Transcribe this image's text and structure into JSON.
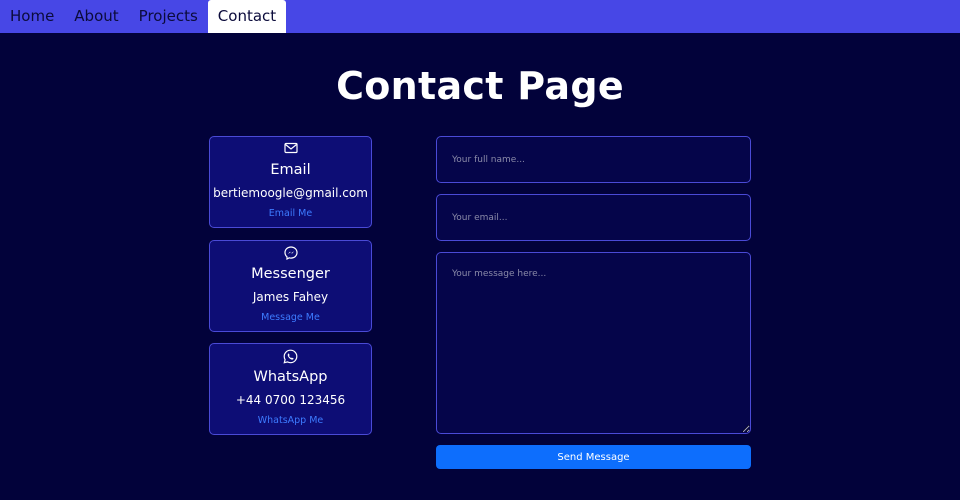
{
  "nav": {
    "items": [
      {
        "label": "Home"
      },
      {
        "label": "About"
      },
      {
        "label": "Projects"
      },
      {
        "label": "Contact"
      }
    ],
    "active": "Contact"
  },
  "page": {
    "title": "Contact Page"
  },
  "contact_cards": [
    {
      "icon": "mail-icon",
      "title": "Email",
      "value": "bertiemoogle@gmail.com",
      "link": "Email Me"
    },
    {
      "icon": "messenger-icon",
      "title": "Messenger",
      "value": "James Fahey",
      "link": "Message Me"
    },
    {
      "icon": "whatsapp-icon",
      "title": "WhatsApp",
      "value": "+44 0700 123456",
      "link": "WhatsApp Me"
    }
  ],
  "form": {
    "name_placeholder": "Your full name...",
    "email_placeholder": "Your email...",
    "message_placeholder": "Your message here...",
    "submit_label": "Send Message"
  },
  "colors": {
    "navbar": "#4747e6",
    "background": "#02023a",
    "card": "#0d0d75",
    "border": "#4a4ad6",
    "link": "#3d7bff",
    "button": "#0d6efd"
  }
}
